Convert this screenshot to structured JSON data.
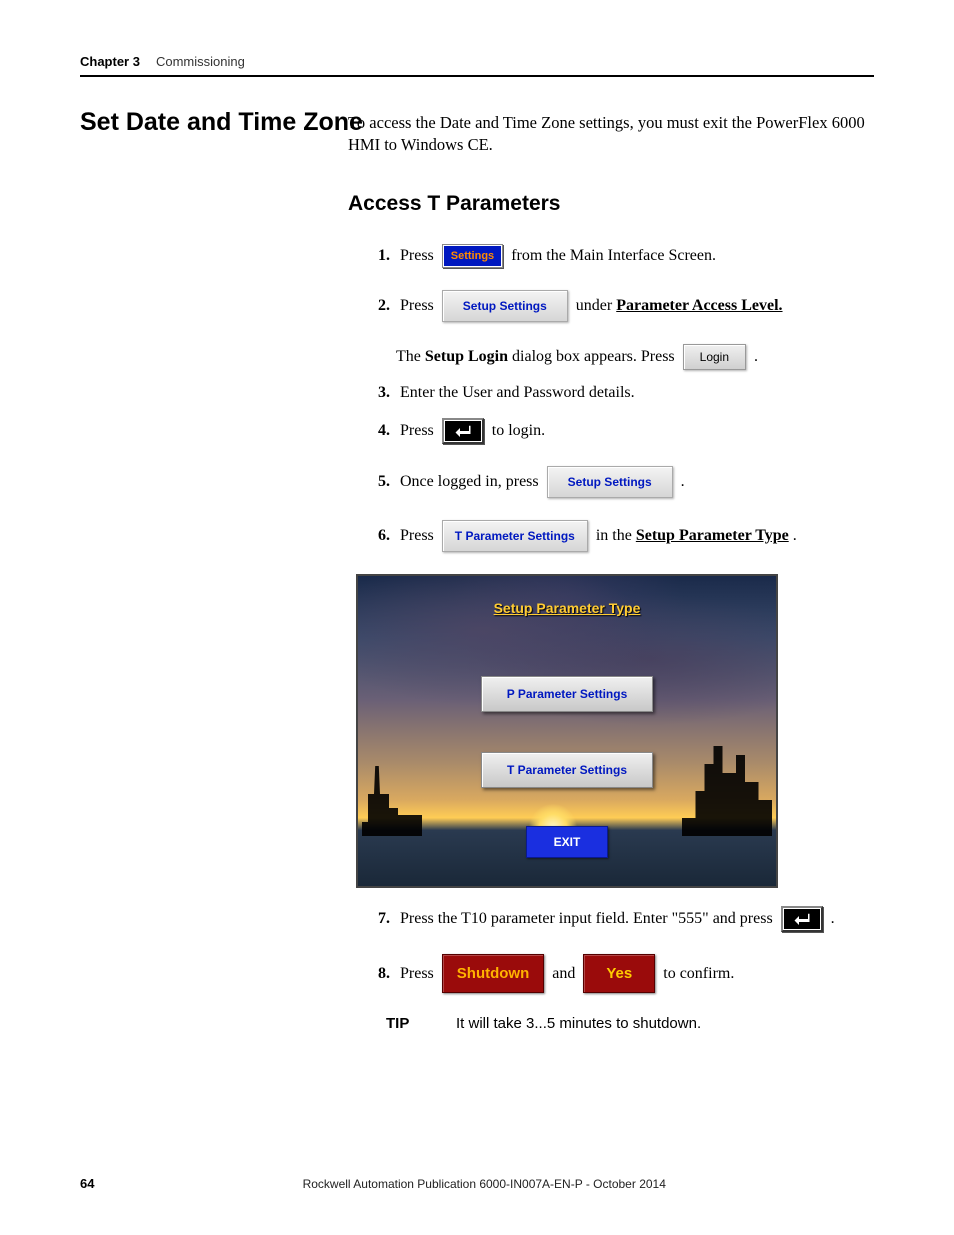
{
  "header": {
    "chapter": "Chapter 3",
    "title": "Commissioning"
  },
  "section_heading": "Set Date and Time Zone",
  "intro": "To access the Date and Time Zone settings, you must exit the PowerFlex 6000 HMI to Windows CE.",
  "subheading": "Access T Parameters",
  "steps": {
    "s1": {
      "num": "1.",
      "pre": "Press",
      "btn": "Settings",
      "post": "from the Main Interface Screen."
    },
    "s2": {
      "num": "2.",
      "pre": "Press",
      "btn": "Setup Settings",
      "post_pre": "under ",
      "post_link": "Parameter Access Level."
    },
    "s2b": {
      "pre1": "The ",
      "b1": "Setup Login",
      "mid": " dialog box appears. Press",
      "btn": "Login",
      "post": "."
    },
    "s3": {
      "num": "3.",
      "text": "Enter the User and Password details."
    },
    "s4": {
      "num": "4.",
      "pre": "Press",
      "post": "to login."
    },
    "s5": {
      "num": "5.",
      "pre": "Once logged in, press",
      "btn": "Setup Settings",
      "post": "."
    },
    "s6": {
      "num": "6.",
      "pre": "Press",
      "btn": "T Parameter Settings",
      "post_pre": "in the ",
      "post_link": "Setup Parameter Type",
      "post_suffix": "."
    },
    "s7": {
      "num": "7.",
      "text": "Press the T10 parameter input field. Enter \"555\" and press",
      "post": "."
    },
    "s8": {
      "num": "8.",
      "pre": "Press",
      "btn1": "Shutdown",
      "mid": "and",
      "btn2": "Yes",
      "post": "to confirm."
    }
  },
  "screenshot": {
    "title": "Setup Parameter Type",
    "p_btn": "P Parameter Settings",
    "t_btn": "T Parameter Settings",
    "exit": "EXIT"
  },
  "tip": {
    "label": "TIP",
    "text": "It will take 3...5 minutes to shutdown."
  },
  "footer": {
    "page": "64",
    "pub": "Rockwell Automation Publication 6000-IN007A-EN-P - October 2014"
  }
}
